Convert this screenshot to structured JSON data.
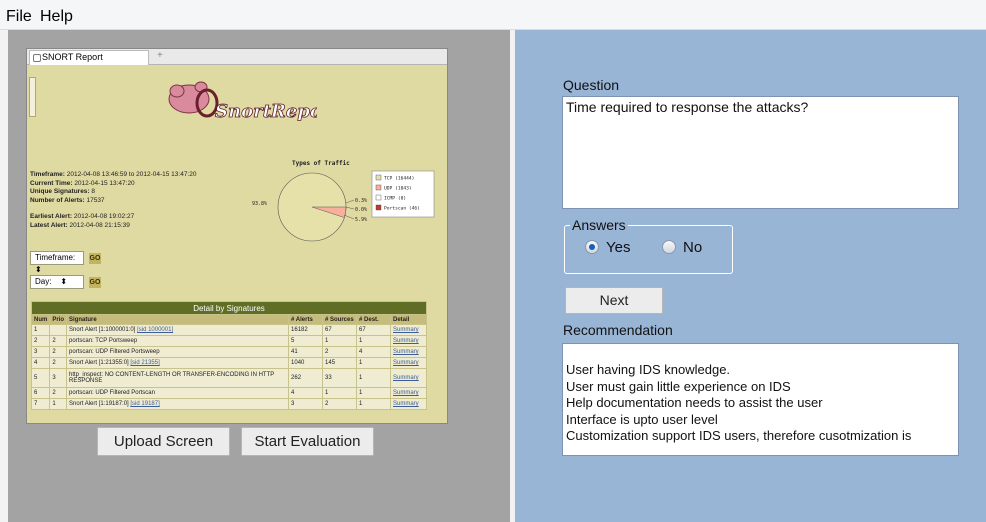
{
  "menu": {
    "file": "File",
    "help": "Help"
  },
  "screenshot": {
    "tab_title": "SNORT Report",
    "new_tab": "+",
    "logo_text": "SnortReport",
    "meta_lines": [
      {
        "key": "Timeframe:",
        "value": "2012-04-08 13:46:59 to 2012-04-15 13:47:20"
      },
      {
        "key": "Current Time:",
        "value": "2012-04-15 13:47:20"
      },
      {
        "key": "Unique Signatures:",
        "value": "8"
      },
      {
        "key": "Number of Alerts:",
        "value": "17537"
      },
      {
        "key": "Earliest Alert:",
        "value": "2012-04-08 19:02:27"
      },
      {
        "key": "Latest Alert:",
        "value": "2012-04-08 21:15:39"
      }
    ],
    "traffic": {
      "title": "Types of Traffic",
      "pct_main": "93.8%",
      "pct_a": "0.3%",
      "pct_b": "0.0%",
      "pct_c": "5.9%",
      "legend": [
        {
          "label": "TCP (16444)",
          "color": "#e6e1a9"
        },
        {
          "label": "UDP (1043)",
          "color": "#f7b09a"
        },
        {
          "label": "ICMP (0)",
          "color": "#ffffff"
        },
        {
          "label": "Portscan (46)",
          "color": "#c0392b"
        }
      ]
    },
    "timeframe_label": "Timeframe:",
    "day_label": "Day:",
    "go": "GO",
    "table": {
      "title": "Detail by Signatures",
      "headers": [
        "Num",
        "Prio",
        "Signature",
        "# Alerts",
        "# Sources",
        "# Dest.",
        "Detail"
      ],
      "rows": [
        {
          "num": "1",
          "prio": "",
          "sig": "Snort Alert [1:1000001:0] ",
          "link": "[sid 1000001]",
          "alerts": "16182",
          "src": "67",
          "dst": "67",
          "detail": "Summary"
        },
        {
          "num": "2",
          "prio": "2",
          "sig": "portscan: TCP Portsweep",
          "link": "",
          "alerts": "5",
          "src": "1",
          "dst": "1",
          "detail": "Summary"
        },
        {
          "num": "3",
          "prio": "2",
          "sig": "portscan: UDP Filtered Portsweep",
          "link": "",
          "alerts": "41",
          "src": "2",
          "dst": "4",
          "detail": "Summary"
        },
        {
          "num": "4",
          "prio": "2",
          "sig": "Snort Alert [1:21355:0] ",
          "link": "[sid 21355]",
          "alerts": "1040",
          "src": "145",
          "dst": "1",
          "detail": "Summary"
        },
        {
          "num": "5",
          "prio": "3",
          "sig": "http_inspect: NO CONTENT-LENGTH OR TRANSFER-ENCODING IN HTTP RESPONSE",
          "link": "",
          "alerts": "262",
          "src": "33",
          "dst": "1",
          "detail": "Summary"
        },
        {
          "num": "6",
          "prio": "2",
          "sig": "portscan: UDP Filtered Portscan",
          "link": "",
          "alerts": "4",
          "src": "1",
          "dst": "1",
          "detail": "Summary"
        },
        {
          "num": "7",
          "prio": "1",
          "sig": "Snort Alert [1:19187:0] ",
          "link": "[sid 19187]",
          "alerts": "3",
          "src": "2",
          "dst": "1",
          "detail": "Summary"
        }
      ]
    }
  },
  "buttons": {
    "upload": "Upload Screen",
    "start": "Start Evaluation",
    "next": "Next"
  },
  "question": {
    "label": "Question",
    "text": "Time required to response the attacks?"
  },
  "answers": {
    "label": "Answers",
    "yes": "Yes",
    "no": "No",
    "selected": "Yes"
  },
  "recommendation": {
    "label": "Recommendation",
    "lines": [
      "User having IDS knowledge.",
      "User must gain little experience on IDS",
      "Help documentation needs to assist the user",
      "Interface is upto user level",
      "Customization support IDS users, therefore cusotmization is"
    ]
  }
}
